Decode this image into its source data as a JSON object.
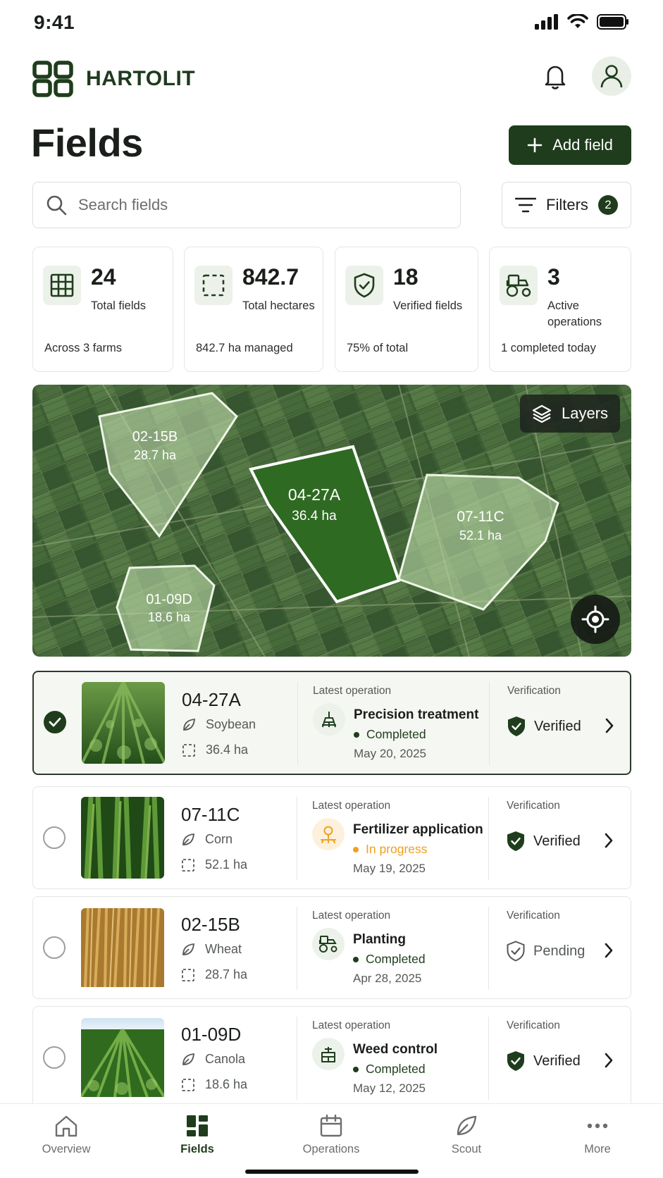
{
  "status_bar": {
    "time": "9:41"
  },
  "app": {
    "brand": "HARTOLIT"
  },
  "page": {
    "title": "Fields",
    "add_button": "Add field"
  },
  "search": {
    "placeholder": "Search fields"
  },
  "filters": {
    "label": "Filters",
    "count": "2"
  },
  "stats": [
    {
      "value": "24",
      "label": "Total fields",
      "sub": "Across 3 farms",
      "icon": "grid-icon"
    },
    {
      "value": "842.7",
      "label": "Total hectares",
      "sub": "842.7 ha managed",
      "icon": "area-icon"
    },
    {
      "value": "18",
      "label": "Verified fields",
      "sub": "75% of total",
      "icon": "shield-check-icon"
    },
    {
      "value": "3",
      "label": "Active operations",
      "sub": "1 completed today",
      "icon": "tractor-icon"
    }
  ],
  "map": {
    "layers_label": "Layers",
    "fields": [
      {
        "id": "02-15B",
        "area": "28.7 ha"
      },
      {
        "id": "04-27A",
        "area": "36.4 ha",
        "selected": true
      },
      {
        "id": "07-11C",
        "area": "52.1 ha"
      },
      {
        "id": "01-09D",
        "area": "18.6 ha"
      }
    ]
  },
  "field_list": {
    "latest_label": "Latest operation",
    "verification_label": "Verification",
    "rows": [
      {
        "id": "04-27A",
        "crop": "Soybean",
        "area": "36.4 ha",
        "operation": "Precision treatment",
        "status": "Completed",
        "status_color": "#1f3d1c",
        "date": "May 20, 2025",
        "verification": "Verified",
        "selected": true
      },
      {
        "id": "07-11C",
        "crop": "Corn",
        "area": "52.1 ha",
        "operation": "Fertilizer application",
        "status": "In progress",
        "status_color": "#f0a020",
        "date": "May 19, 2025",
        "verification": "Verified",
        "selected": false
      },
      {
        "id": "02-15B",
        "crop": "Wheat",
        "area": "28.7 ha",
        "operation": "Planting",
        "status": "Completed",
        "status_color": "#1f3d1c",
        "date": "Apr 28, 2025",
        "verification": "Pending",
        "selected": false
      },
      {
        "id": "01-09D",
        "crop": "Canola",
        "area": "18.6 ha",
        "operation": "Weed control",
        "status": "Completed",
        "status_color": "#1f3d1c",
        "date": "May 12, 2025",
        "verification": "Verified",
        "selected": false
      }
    ]
  },
  "tabs": [
    {
      "label": "Overview",
      "icon": "home-icon"
    },
    {
      "label": "Fields",
      "icon": "fields-icon",
      "active": true
    },
    {
      "label": "Operations",
      "icon": "calendar-icon"
    },
    {
      "label": "Scout",
      "icon": "leaf-icon"
    },
    {
      "label": "More",
      "icon": "more-icon"
    }
  ],
  "colors": {
    "primary": "#1f3d1c",
    "in_progress": "#f0a020",
    "card_border": "#e4e7e3"
  }
}
